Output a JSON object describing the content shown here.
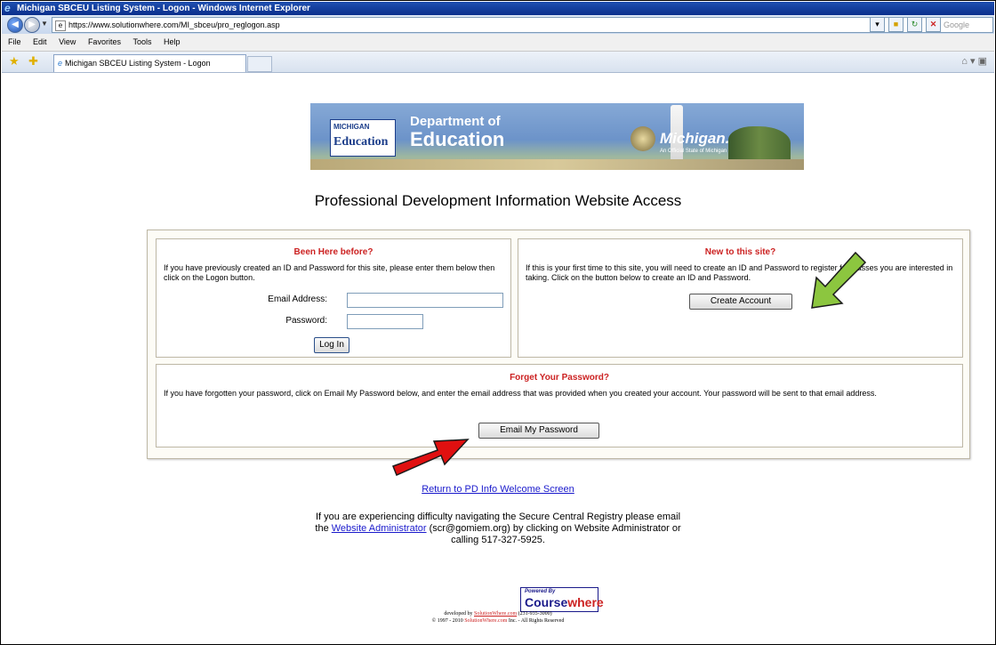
{
  "window": {
    "title": "Michigan SBCEU Listing System - Logon - Windows Internet Explorer"
  },
  "browser": {
    "url": "https://www.solutionwhere.com/MI_sbceu/pro_reglogon.asp",
    "search_placeholder": "Google",
    "menu": [
      "File",
      "Edit",
      "View",
      "Favorites",
      "Tools",
      "Help"
    ],
    "tab_title": "Michigan SBCEU Listing System - Logon"
  },
  "banner": {
    "left_logo_small": "MICHIGAN",
    "left_logo_big": "Education",
    "dept_line1": "Department of",
    "dept_line2": "Education",
    "right_logo": "Michigan.gov",
    "right_sub": "An Official State of Michigan Web Site"
  },
  "page_title": "Professional Development Information Website Access",
  "login_box": {
    "heading": "Been Here before?",
    "text": "If you have previously created an ID and Password for this site, please enter them below then click on the Logon button.",
    "email_label": "Email Address:",
    "password_label": "Password:",
    "login_button": "Log In"
  },
  "new_box": {
    "heading": "New to this site?",
    "text": "If this is your first time to this site, you will need to create an ID and Password to register for classes you are interested in taking. Click on the button below to create an ID and Password.",
    "button": "Create Account"
  },
  "forgot_box": {
    "heading": "Forget Your Password?",
    "text": "If you have forgotten your password, click on Email My Password below, and enter the email address that was provided when you created your account. Your password will be sent to that email address.",
    "button": "Email My Password"
  },
  "return_link": "Return to PD Info Welcome Screen",
  "help": {
    "line1": "If you are experiencing difficulty navigating the Secure Central Registry please email",
    "the": "the",
    "link": "Website Administrator",
    "line2_rest": "(scr@gomiem.org) by clicking on Website Administrator or",
    "line3": "calling 517-327-5925."
  },
  "footer": {
    "powered_by": "Powered By",
    "brand_a": "Course",
    "brand_b": "where",
    "developed": "developed by",
    "developer_link": "SolutionWhere.com",
    "phone": "(231-935-3000)",
    "copyright_prefix": "© 1997 - 2010",
    "copyright_brand": "SolutionWhere.com",
    "copyright_suffix": "Inc. - All Rights Reserved"
  },
  "colors": {
    "heading_red": "#cc2222",
    "link_blue": "#1a1acc",
    "green_arrow": "#8cc63f",
    "red_arrow": "#e01010"
  }
}
